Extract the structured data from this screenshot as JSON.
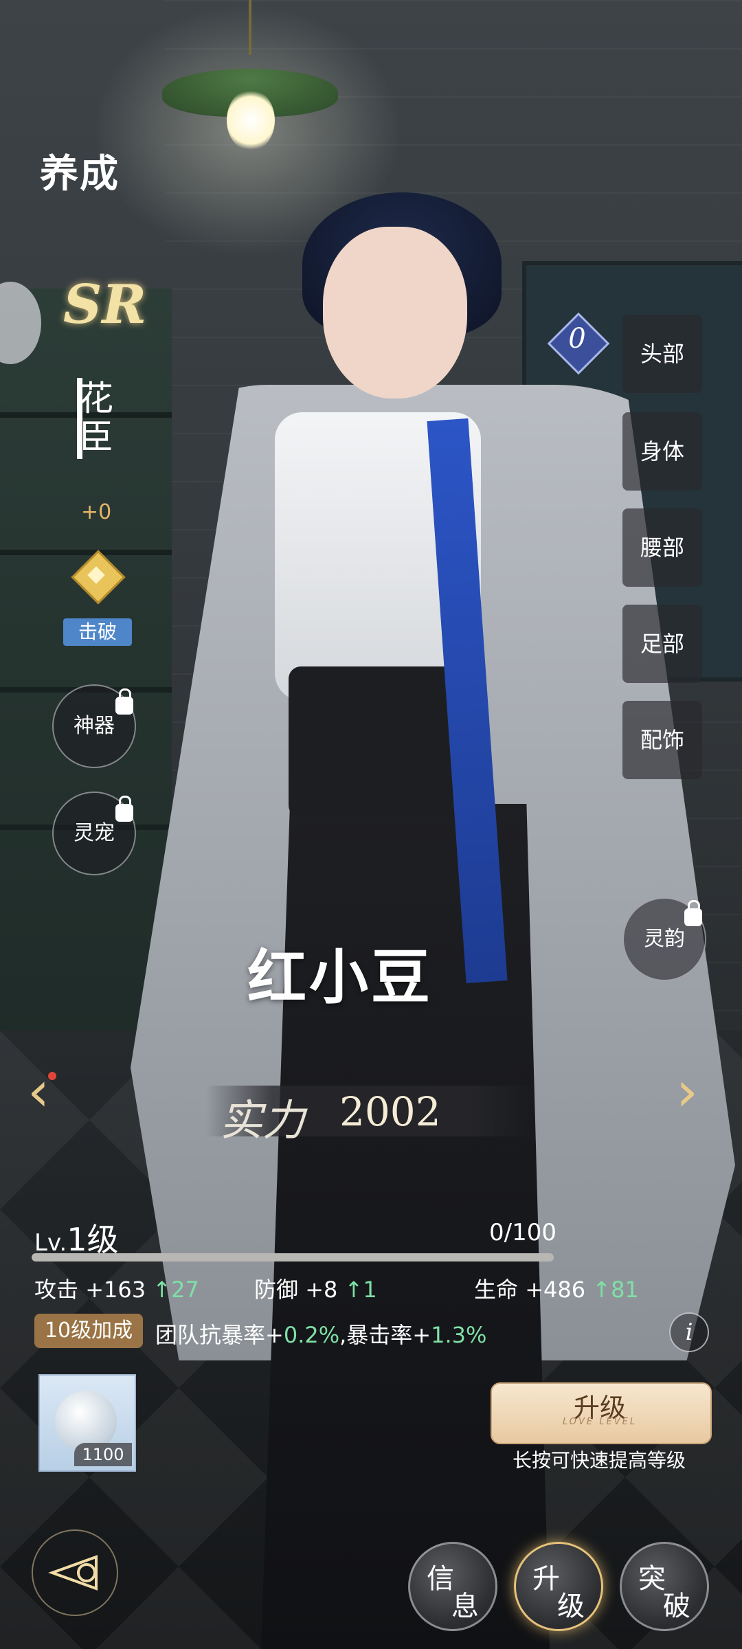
{
  "header": {
    "title": "养成"
  },
  "card": {
    "rarity": "SR",
    "name_vertical": "花臣",
    "enhance": "+0",
    "break_badge": "击破"
  },
  "side_buttons": [
    {
      "label": "神器",
      "locked": true
    },
    {
      "label": "灵宠",
      "locked": true
    }
  ],
  "equip_slots": {
    "count": "0",
    "items": [
      "头部",
      "身体",
      "腰部",
      "足部",
      "配饰"
    ]
  },
  "spirit_button": {
    "label": "灵韵",
    "locked": true
  },
  "character": {
    "name": "红小豆"
  },
  "power": {
    "label": "实力",
    "value": "2002"
  },
  "level": {
    "prefix": "Lv.",
    "value": "1级",
    "xp": "0/100",
    "progress": 0.0
  },
  "stats": [
    {
      "name": "攻击",
      "value": "+163",
      "gain": "27"
    },
    {
      "name": "防御",
      "value": "+8",
      "gain": "1"
    },
    {
      "name": "生命",
      "value": "+486",
      "gain": "81"
    }
  ],
  "bonus": {
    "tag": "10级加成",
    "text_a": "团队抗暴率+",
    "val_a": "0.2%",
    "text_b": ",暴击率+",
    "val_b": "1.3%"
  },
  "item": {
    "count": "1100"
  },
  "upgrade": {
    "label": "升级",
    "sub": "LOVE LEVEL",
    "hint": "长按可快速提高等级"
  },
  "bottom_nav": [
    {
      "a": "信",
      "b": "息"
    },
    {
      "a": "升",
      "b": "级"
    },
    {
      "a": "突",
      "b": "破"
    }
  ],
  "colors": {
    "stat_gain": "#7fe0a6",
    "accent_gold": "#e6c27a",
    "badge_blue": "#4f86c9"
  }
}
